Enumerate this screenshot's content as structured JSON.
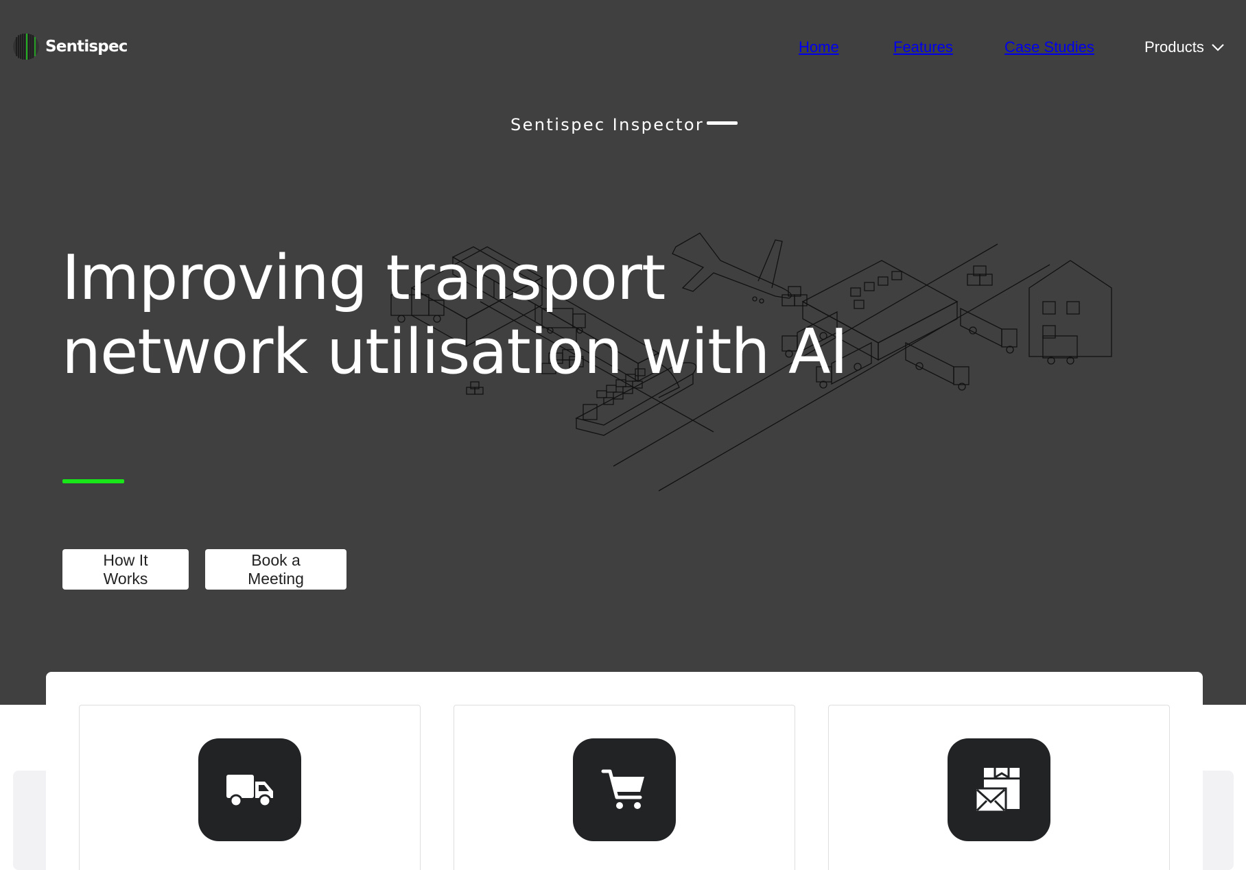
{
  "brand": {
    "name": "Sentispec",
    "logo_icon": "sentispec-logo-icon"
  },
  "nav": {
    "items": [
      {
        "label": "Home"
      },
      {
        "label": "Features"
      },
      {
        "label": "Case Studies"
      },
      {
        "label": "Products",
        "icon": "chevron-down-icon"
      }
    ]
  },
  "hero": {
    "tagline": "Sentispec Inspector",
    "headline_line1": "Improving transport",
    "headline_line2": "network utilisation with AI",
    "accent_color": "#19e619",
    "buttons": [
      {
        "label": "How It Works"
      },
      {
        "label": "Book a Meeting"
      }
    ]
  },
  "features": {
    "cards": [
      {
        "icon": "truck-icon"
      },
      {
        "icon": "shopping-cart-icon"
      },
      {
        "icon": "parcel-mail-icon"
      }
    ]
  },
  "colors": {
    "hero_background": "#404040",
    "icon_tile": "#212325",
    "section_background": "#ffffff"
  }
}
